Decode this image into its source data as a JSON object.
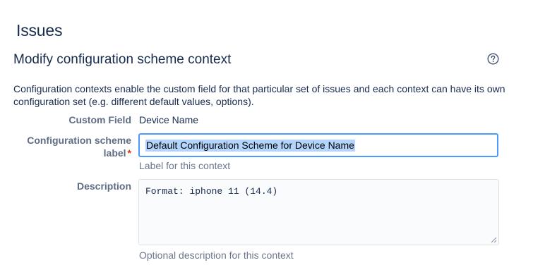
{
  "page": {
    "title": "Issues"
  },
  "section": {
    "title": "Modify configuration scheme context",
    "help_icon": "question-circle-icon"
  },
  "intro": {
    "text": "Configuration contexts enable the custom field for that particular set of issues and each context can have its own configuration set (e.g. different default values, options)."
  },
  "form": {
    "custom_field": {
      "label": "Custom Field",
      "value": "Device Name"
    },
    "scheme_label": {
      "label_line1": "Configuration scheme",
      "label_line2": "label",
      "required_marker": "*",
      "value": "Default Configuration Scheme for Device Name",
      "help": "Label for this context"
    },
    "description": {
      "label": "Description",
      "value": "Format: iphone 11 (14.4)",
      "help": "Optional description for this context"
    }
  },
  "colors": {
    "text": "#172b4d",
    "label": "#5e6c84",
    "help": "#6b778c",
    "focus_border": "#4c9aff",
    "selection": "#b3d4fc",
    "required": "#de350b"
  }
}
